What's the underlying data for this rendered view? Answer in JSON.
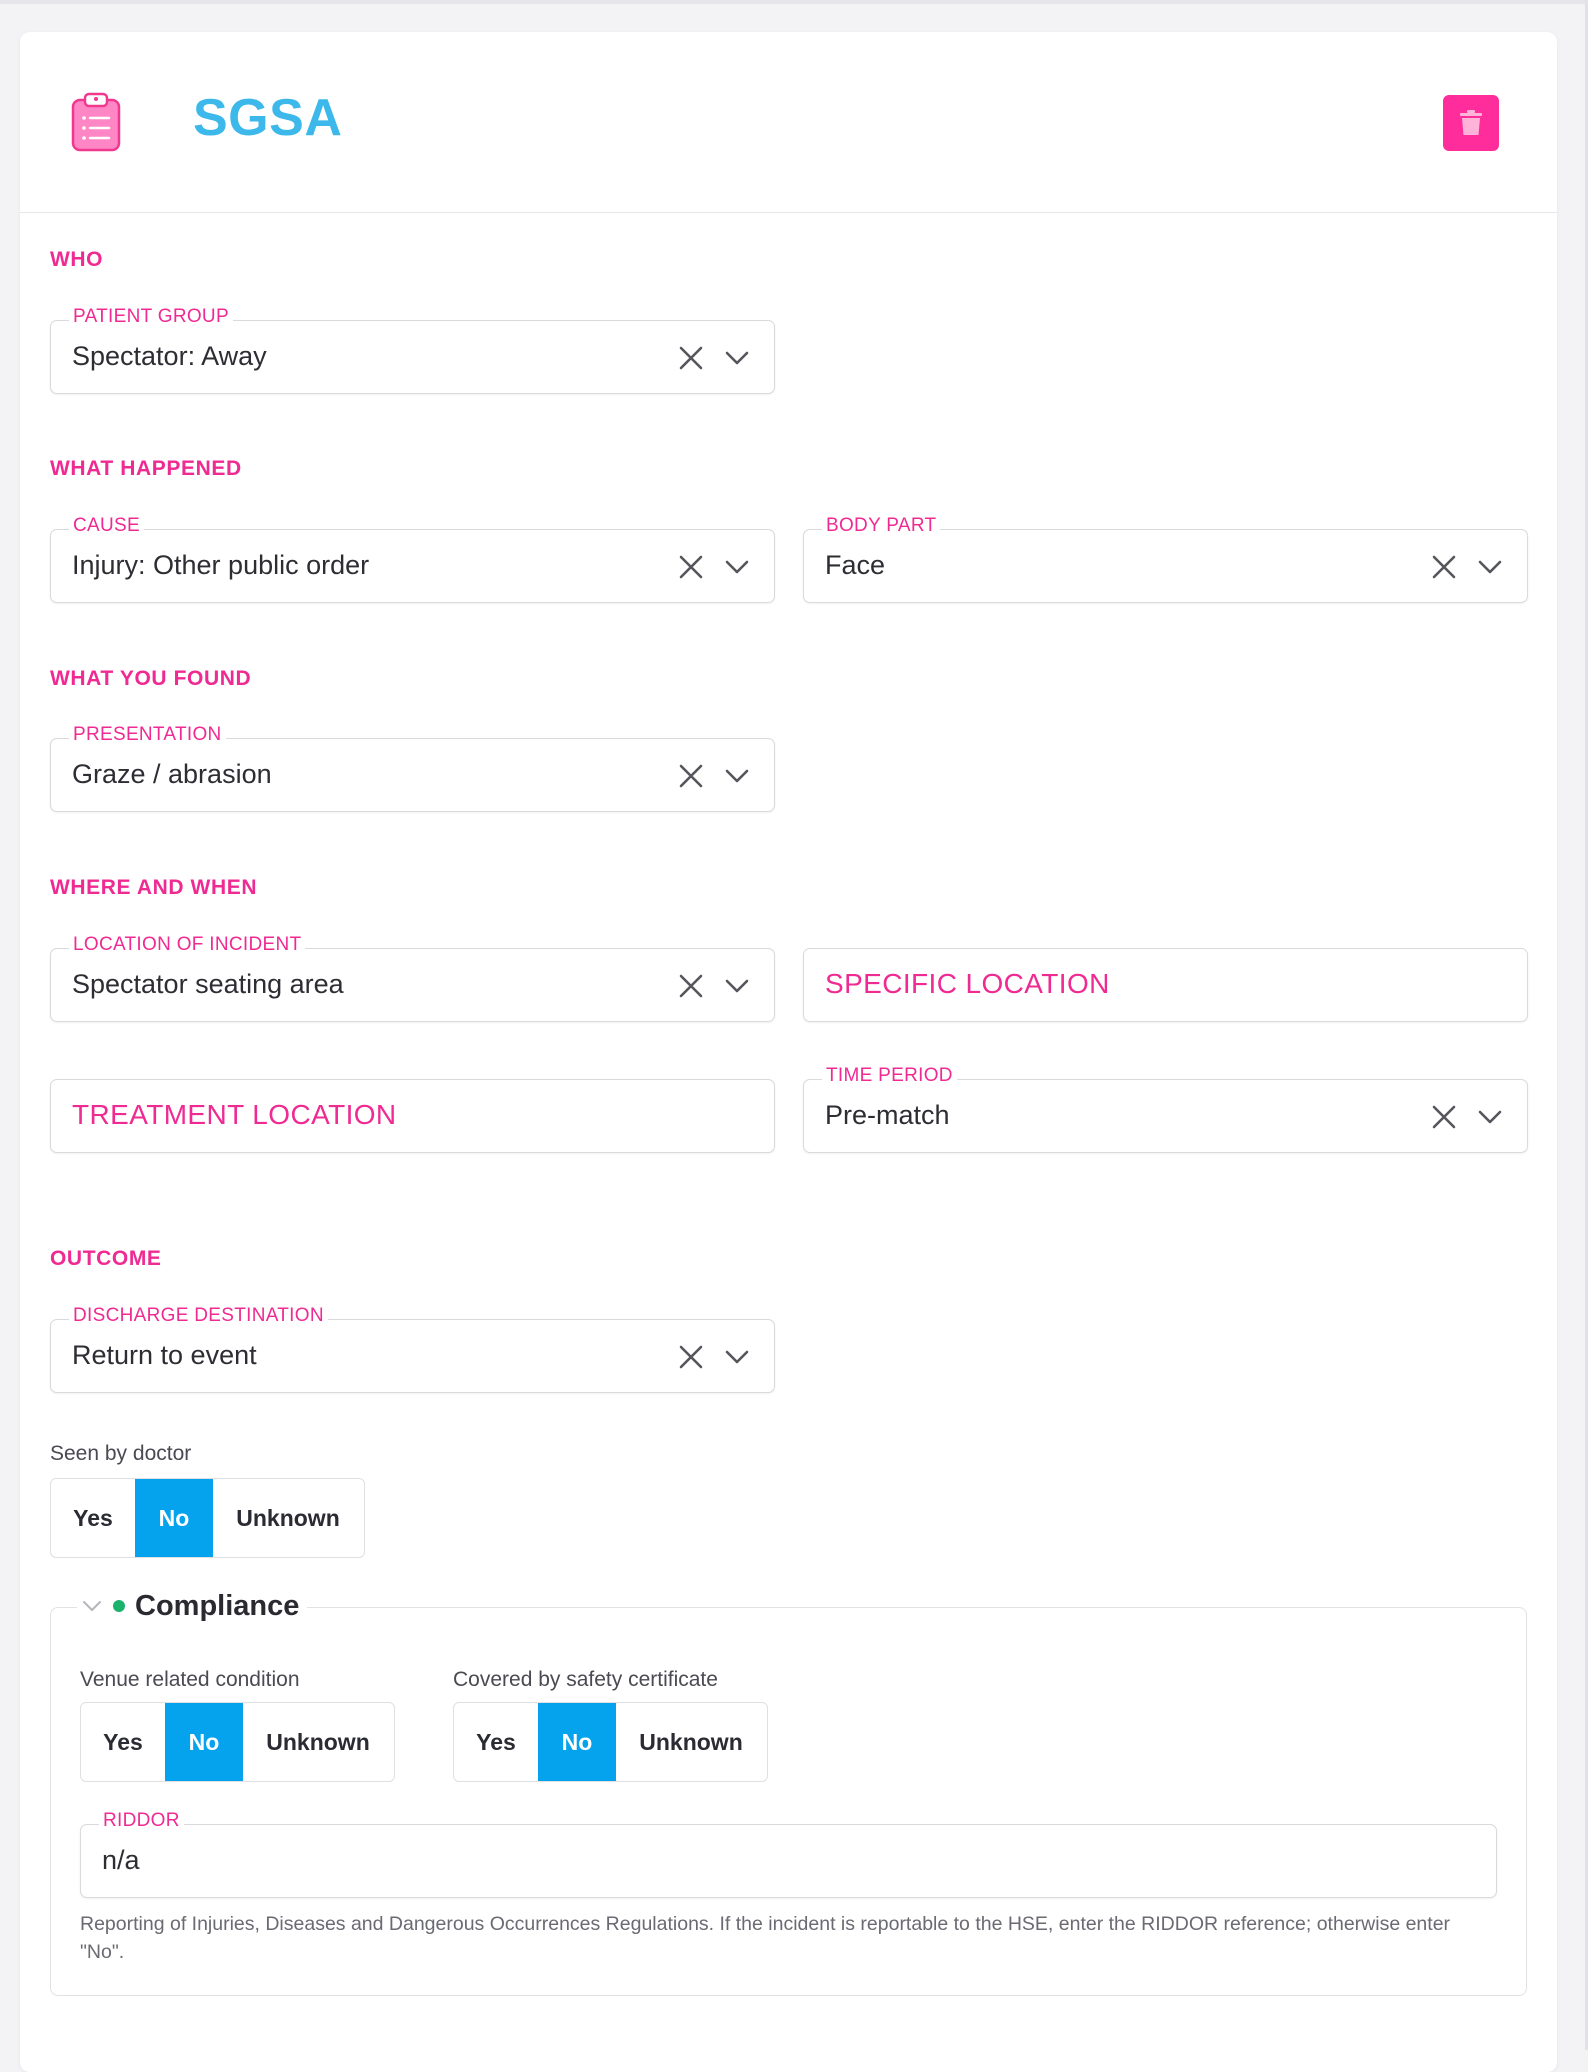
{
  "card": {
    "title": "SGSA"
  },
  "sections": {
    "who": "WHO",
    "what_happened": "WHAT HAPPENED",
    "what_you_found": "WHAT YOU FOUND",
    "where_and_when": "WHERE AND WHEN",
    "outcome": "OUTCOME"
  },
  "fields": {
    "patient_group": {
      "label": "PATIENT GROUP",
      "value": "Spectator: Away"
    },
    "cause": {
      "label": "CAUSE",
      "value": "Injury: Other public order"
    },
    "body_part": {
      "label": "BODY PART",
      "value": "Face"
    },
    "presentation": {
      "label": "PRESENTATION",
      "value": "Graze / abrasion"
    },
    "location_of_incident": {
      "label": "LOCATION OF INCIDENT",
      "value": "Spectator seating area"
    },
    "specific_location": {
      "placeholder": "SPECIFIC LOCATION"
    },
    "treatment_location": {
      "placeholder": "TREATMENT LOCATION"
    },
    "time_period": {
      "label": "TIME PERIOD",
      "value": "Pre-match"
    },
    "discharge_destination": {
      "label": "DISCHARGE DESTINATION",
      "value": "Return to event"
    }
  },
  "seen_by_doctor": {
    "label": "Seen by doctor",
    "options": [
      "Yes",
      "No",
      "Unknown"
    ],
    "selected": "No"
  },
  "compliance": {
    "title": "Compliance",
    "status_color": "#1bb36b",
    "venue_related": {
      "label": "Venue related condition",
      "options": [
        "Yes",
        "No",
        "Unknown"
      ],
      "selected": "No"
    },
    "covered_by_certificate": {
      "label": "Covered by safety certificate",
      "options": [
        "Yes",
        "No",
        "Unknown"
      ],
      "selected": "No"
    },
    "riddor": {
      "label": "RIDDOR",
      "value": "n/a",
      "help": "Reporting of Injuries, Diseases and Dangerous Occurrences Regulations. If the incident is reportable to the HSE, enter the RIDDOR reference; otherwise enter \"No\"."
    }
  },
  "colors": {
    "accent_pink": "#ef2a92",
    "title_blue": "#3db8ea",
    "toggle_active": "#05a3ee",
    "delete_button": "#ff2d9c"
  },
  "icons": {
    "header": "clipboard-icon",
    "delete": "trash-icon",
    "clear": "close-icon",
    "dropdown": "chevron-down-icon",
    "collapse": "chevron-down-icon"
  }
}
